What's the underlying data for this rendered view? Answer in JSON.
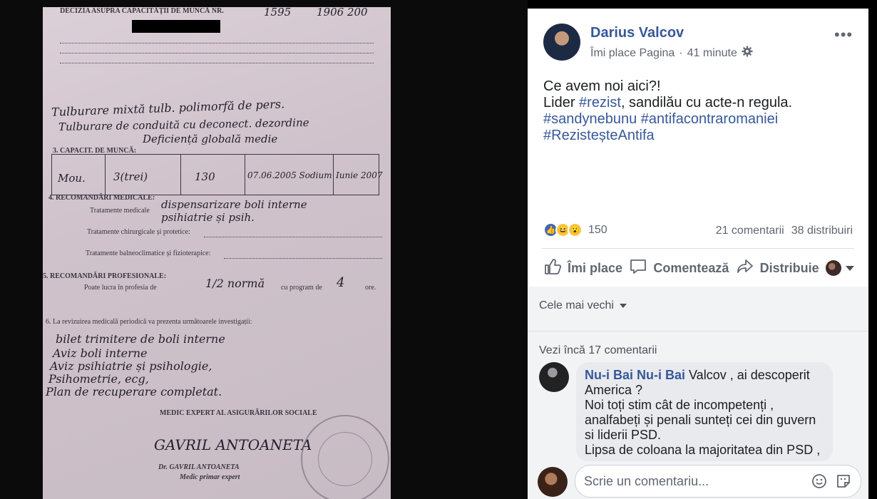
{
  "document": {
    "header": "DECIZIA ASUPRA CAPACITĂȚII DE MUNCĂ  NR.",
    "number_hand": "1595",
    "date_hand": "1906 200",
    "sections": {
      "capacity": "3. CAPACIT. DE MUNCĂ:",
      "medical": "4. RECOMANDĂRI MEDICALE:",
      "treat_medical": "Tratamente medicale",
      "treat_surgical": "Tratamente chirurgicale și protetice:",
      "treat_balneo": "Tratamente balneoclimatice și fizioterapice:",
      "professional": "5. RECOMANDĂRI PROFESIONALE:",
      "can_work": "Poate lucra în profesia de",
      "program": "cu program de",
      "hours": "ore.",
      "revision": "6. La revizuirea medicală periodică va prezenta următoarele investigații:"
    },
    "handwriting": {
      "diagnosis_1": "Tulburare mixtă tulb. polimorfă de pers.",
      "diagnosis_2": "Tulburare de conduită cu deconect. dezordine",
      "diagnosis_3": "Deficiență globală medie",
      "grid_1": "Mou.",
      "grid_2": "3(trei)",
      "grid_3": "130",
      "grid_4": "07.06.2005 Sodium",
      "grid_5": "Iunie 2007",
      "treatment": "dispensarizare boli interne psihiatrie și psih.",
      "profession": "1/2 normă",
      "program_value": "4",
      "rev_1": "bilet trimitere de boli interne",
      "rev_2": "Aviz boli interne",
      "rev_3": "Aviz psihiatrie și psihologie,",
      "rev_4": "Psihometrie, ecg,",
      "rev_5": "Plan de recuperare completat."
    },
    "footer": "MEDIC EXPERT AL ASIGURĂRILOR SOCIALE",
    "signature": "GAVRIL ANTOANETA",
    "stamp_name": "Dr. GAVRIL ANTOANETA",
    "stamp_title": "Medic primar expert"
  },
  "post": {
    "author": "Darius Valcov",
    "meta_like": "Îmi place Pagina",
    "meta_dot": "·",
    "meta_time": "41 minute",
    "text_line1": "Ce avem noi aici?!",
    "text_line2_prefix": "Lider ",
    "tag_rezist": "#rezist",
    "text_line2_suffix": ", sandilău cu acte-n regula.",
    "tag_sandy": "#sandynebunu",
    "tag_antifa": "#antifacontraromaniei",
    "tag_rezistente": "#RezisteșteAntifa",
    "reactions_count": "150",
    "comments_count": "21 comentarii",
    "shares_count": "38 distribuiri",
    "action_like": "Îmi place",
    "action_comment": "Comentează",
    "action_share": "Distribuie",
    "icons": {
      "like": "like-icon",
      "comment": "comment-icon",
      "share": "share-icon",
      "settings": "gear-icon",
      "more": "more-icon"
    }
  },
  "comments": {
    "sort_label": "Cele mai vechi",
    "view_more": "Vezi încă 17 comentarii",
    "first": {
      "author": "Nu-i Bai Nu-i Bai",
      "text_1": " Valcov , ai descoperit America ?",
      "text_2": "Noi toți stim cât de incompetenți , analfabeți și penali sunteți cei din guvern si liderii PSD.",
      "text_3": "Lipsa de coloana la majoritatea din PSD ,"
    },
    "input_placeholder": "Scrie un comentariu..."
  }
}
